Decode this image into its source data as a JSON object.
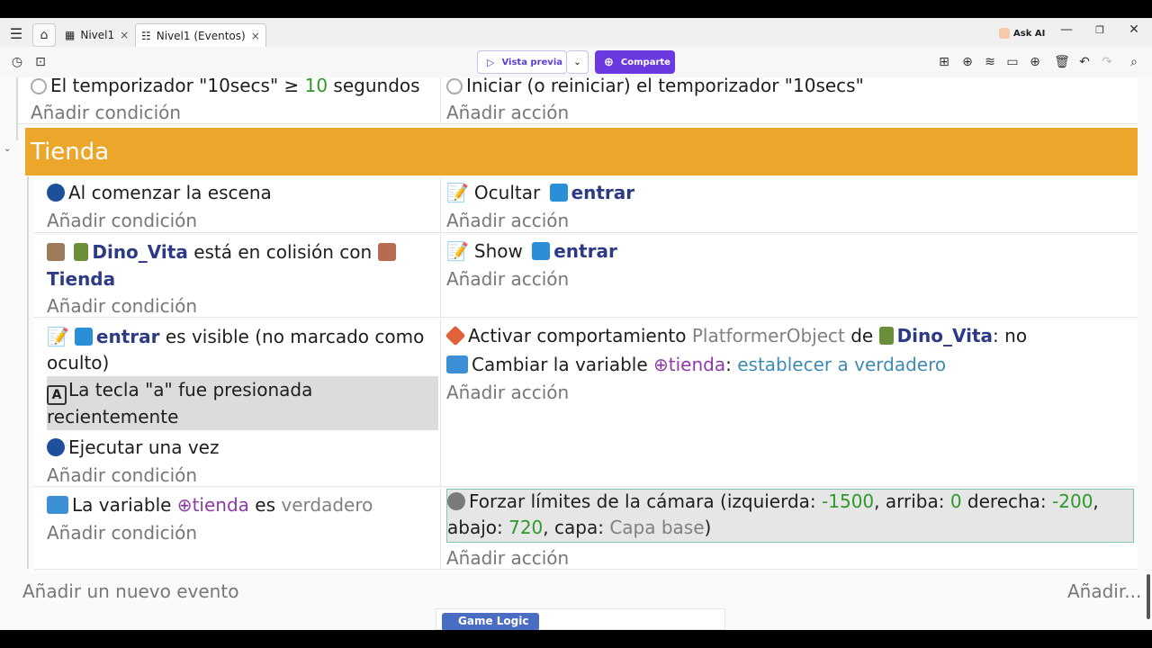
{
  "tabs": [
    {
      "label": "Nivel1",
      "close": "×"
    },
    {
      "label": "Nivel1 (Eventos)",
      "close": "×"
    }
  ],
  "ask_ai": "Ask AI",
  "toolbar": {
    "preview_label": "Vista previa",
    "share_label": "Comparte"
  },
  "events": {
    "timer_condition": {
      "pre": "El temporizador \"10secs\" ≥ ",
      "value": "10",
      "post": " segundos"
    },
    "timer_action": "Iniciar (o reiniciar) el temporizador \"10secs\"",
    "add_condition": "Añadir condición",
    "add_action": "Añadir acción",
    "group_title": "Tienda",
    "e1_condition": "Al comenzar la escena",
    "e1_action": {
      "verb": "Ocultar",
      "object": "entrar"
    },
    "e2_condition": {
      "object": "Dino_Vita",
      "text": " está en colisión con ",
      "target": "Tienda"
    },
    "e2_action": {
      "verb": "Show",
      "object": "entrar"
    },
    "e3_condition": {
      "object": "entrar",
      "text_line1": " es visible (no marcado como",
      "text_line2": "oculto)"
    },
    "e3_action1": {
      "pre": "Activar comportamiento ",
      "behavior": "PlatformerObject",
      "mid": " de ",
      "object": "Dino_Vita",
      "post": ": no"
    },
    "e3_action2": {
      "pre": "Cambiar la variable ",
      "variable": "tienda",
      "post": ": ",
      "value": "establecer a verdadero"
    },
    "e3_sub_key": {
      "line1": "La tecla \"a\" fue presionada",
      "line2": "recientemente"
    },
    "e3_sub_once": "Ejecutar una vez",
    "e4_condition": {
      "pre": "La variable ",
      "variable": "tienda",
      "mid": " es ",
      "value": "verdadero"
    },
    "e4_action": {
      "pre": "Forzar límites de la cámara (izquierda: ",
      "left": "-1500",
      "t1": ", arriba: ",
      "top": "0",
      "t2": " derecha: ",
      "right": "-200",
      "t3": ",",
      "line2_pre": "abajo: ",
      "bottom": "720",
      "t4": ", capa: ",
      "layer": "Capa base",
      "t5": ")"
    },
    "add_new_event": "Añadir un nuevo evento",
    "add_more": "Añadir..."
  },
  "bottom_preview": {
    "label": "Game Logic"
  },
  "colors": {
    "group_header": "#eba62b",
    "accent": "#6a39e0",
    "object": "#2d3a86",
    "number": "#2e9a2a",
    "variable": "#8e3aa6"
  }
}
